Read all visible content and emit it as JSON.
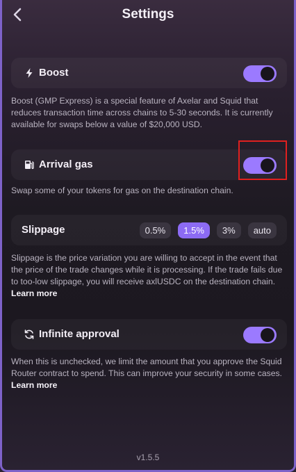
{
  "header": {
    "title": "Settings",
    "back_icon": "chevron-left-icon"
  },
  "boost": {
    "label": "Boost",
    "icon": "lightning-icon",
    "enabled": true,
    "description": "Boost (GMP Express) is a special feature of Axelar and Squid that reduces transaction time across chains to 5-30 seconds. It is currently available for swaps below a value of $20,000 USD."
  },
  "arrival_gas": {
    "label": "Arrival gas",
    "icon": "gas-pump-icon",
    "enabled": true,
    "description": "Swap some of your tokens for gas on the destination chain."
  },
  "slippage": {
    "label": "Slippage",
    "options": [
      "0.5%",
      "1.5%",
      "3%",
      "auto"
    ],
    "selected": "1.5%",
    "description": "Slippage is the price variation you are willing to accept in the event that the price of the trade changes while it is processing. If the trade fails due to too-low slippage, you will receive axlUSDC on the destination chain.",
    "link": "Learn more"
  },
  "infinite_approval": {
    "label": "Infinite approval",
    "icon": "refresh-icon",
    "enabled": true,
    "description": "When this is unchecked, we limit the amount that you approve the Squid Router contract to spend. This can improve your security in some cases.",
    "link": "Learn more"
  },
  "version": "v1.5.5",
  "colors": {
    "accent": "#9b7aff",
    "chip_active": "#8c6bf4",
    "highlight": "#e0201f"
  }
}
